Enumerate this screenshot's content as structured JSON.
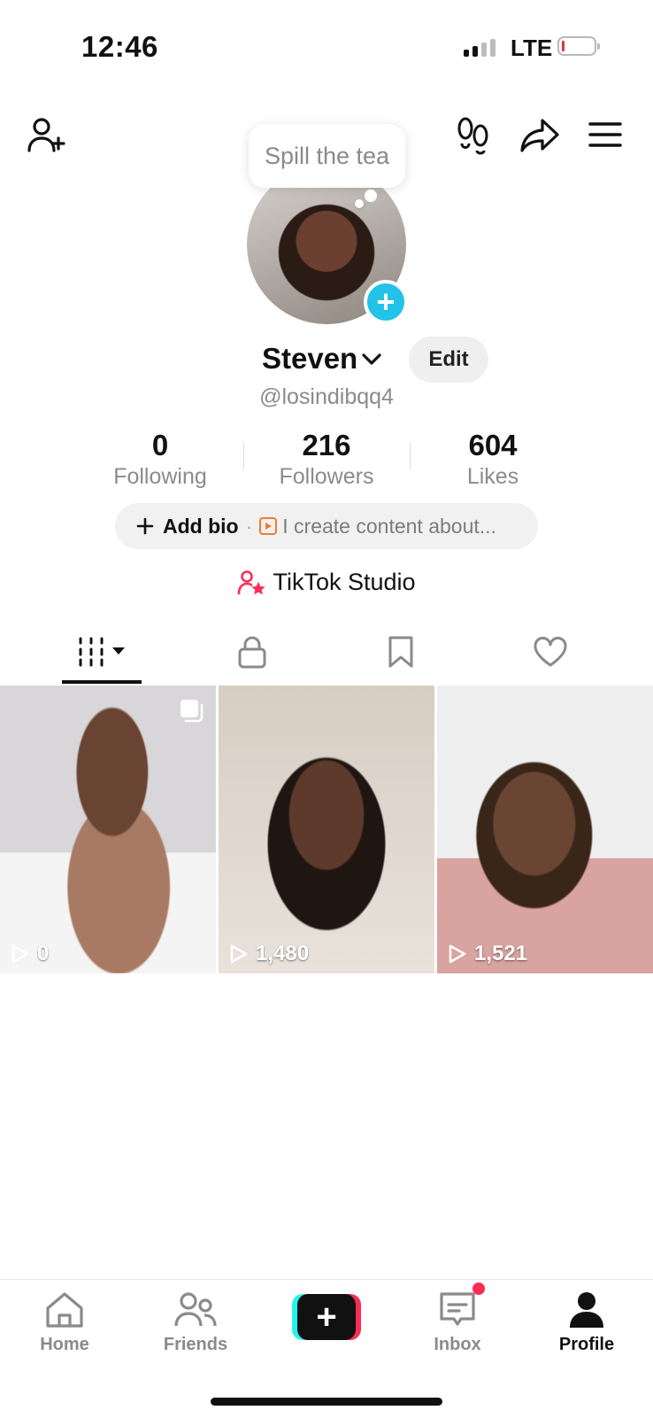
{
  "status_bar": {
    "time": "12:46",
    "network": "LTE"
  },
  "tooltip": {
    "text": "Spill the tea"
  },
  "profile": {
    "display_name": "Steven",
    "edit_label": "Edit",
    "handle": "@losindibqq4"
  },
  "stats": [
    {
      "value": "0",
      "label": "Following"
    },
    {
      "value": "216",
      "label": "Followers"
    },
    {
      "value": "604",
      "label": "Likes"
    }
  ],
  "bio": {
    "add_label": "Add bio",
    "separator": "·",
    "placeholder": "I create content about..."
  },
  "studio": {
    "label": "TikTok Studio"
  },
  "videos": [
    {
      "views": "0"
    },
    {
      "views": "1,480"
    },
    {
      "views": "1,521"
    }
  ],
  "nav": {
    "home": "Home",
    "friends": "Friends",
    "inbox": "Inbox",
    "profile": "Profile"
  },
  "colors": {
    "accent_cyan": "#22c3e8",
    "brand_red": "#fe2c55",
    "brand_teal": "#25f4ee"
  }
}
